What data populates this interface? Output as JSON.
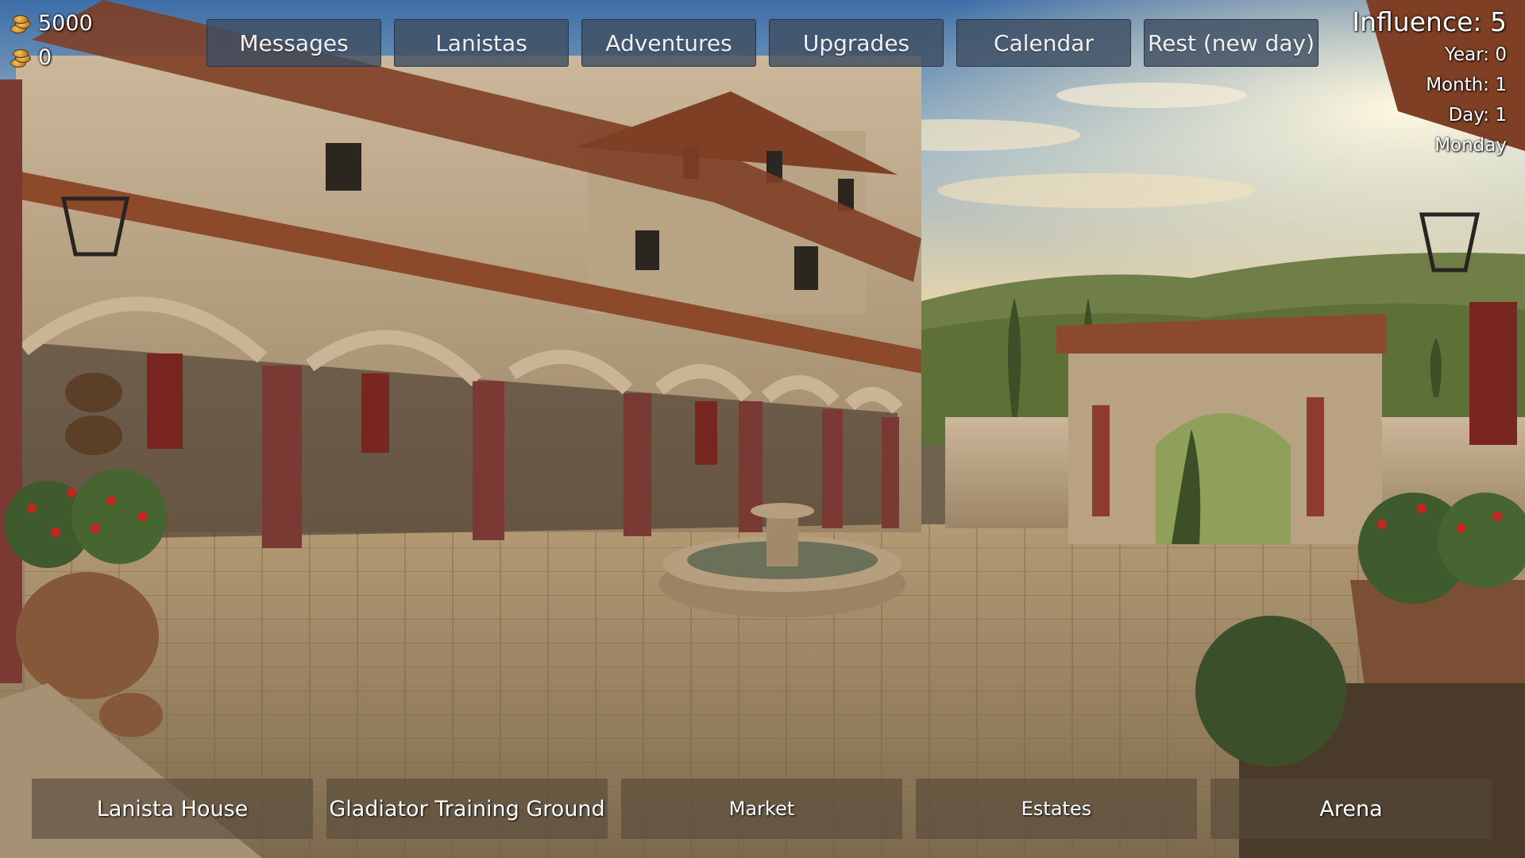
{
  "resources": {
    "gold": "5000",
    "secondary": "0",
    "icon": "coin-stack-icon"
  },
  "top_nav": [
    {
      "label": "Messages"
    },
    {
      "label": "Lanistas"
    },
    {
      "label": "Adventures"
    },
    {
      "label": "Upgrades"
    },
    {
      "label": "Calendar"
    },
    {
      "label": "Rest (new day)"
    }
  ],
  "status": {
    "influence": "Influence: 5",
    "year": "Year: 0",
    "month": "Month: 1",
    "day": "Day: 1",
    "weekday": "Monday"
  },
  "bottom_nav": [
    {
      "label": "Lanista House"
    },
    {
      "label": "Gladiator Training Ground"
    },
    {
      "label": "Market"
    },
    {
      "label": "Estates"
    },
    {
      "label": "Arena"
    }
  ],
  "colors": {
    "top_button_bg": "#3e4e62",
    "bottom_button_bg": "#554838",
    "text": "#ffffff"
  }
}
